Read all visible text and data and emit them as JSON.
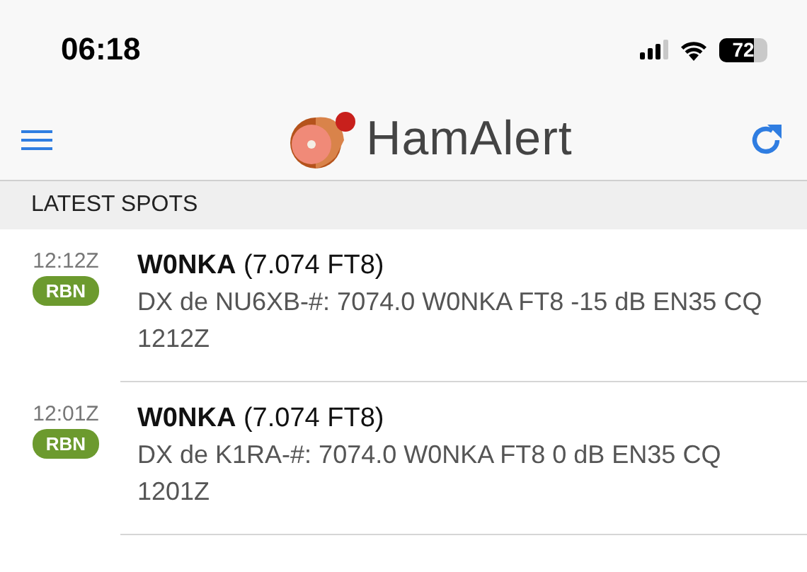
{
  "status_bar": {
    "time": "06:18",
    "battery": "72"
  },
  "header": {
    "title": "HamAlert"
  },
  "section": {
    "title": "LATEST SPOTS"
  },
  "spots": [
    {
      "time": "12:12Z",
      "source": "RBN",
      "headline": "**W0NKA** (7.074 FT8)",
      "detail": "DX de NU6XB-#: 7074.0 W0NKA FT8 -15 dB EN35 CQ 1212Z"
    },
    {
      "time": "12:01Z",
      "source": "RBN",
      "headline": "**W0NKA** (7.074 FT8)",
      "detail": "DX de K1RA-#: 7074.0 W0NKA FT8 0 dB EN35 CQ 1201Z"
    }
  ]
}
